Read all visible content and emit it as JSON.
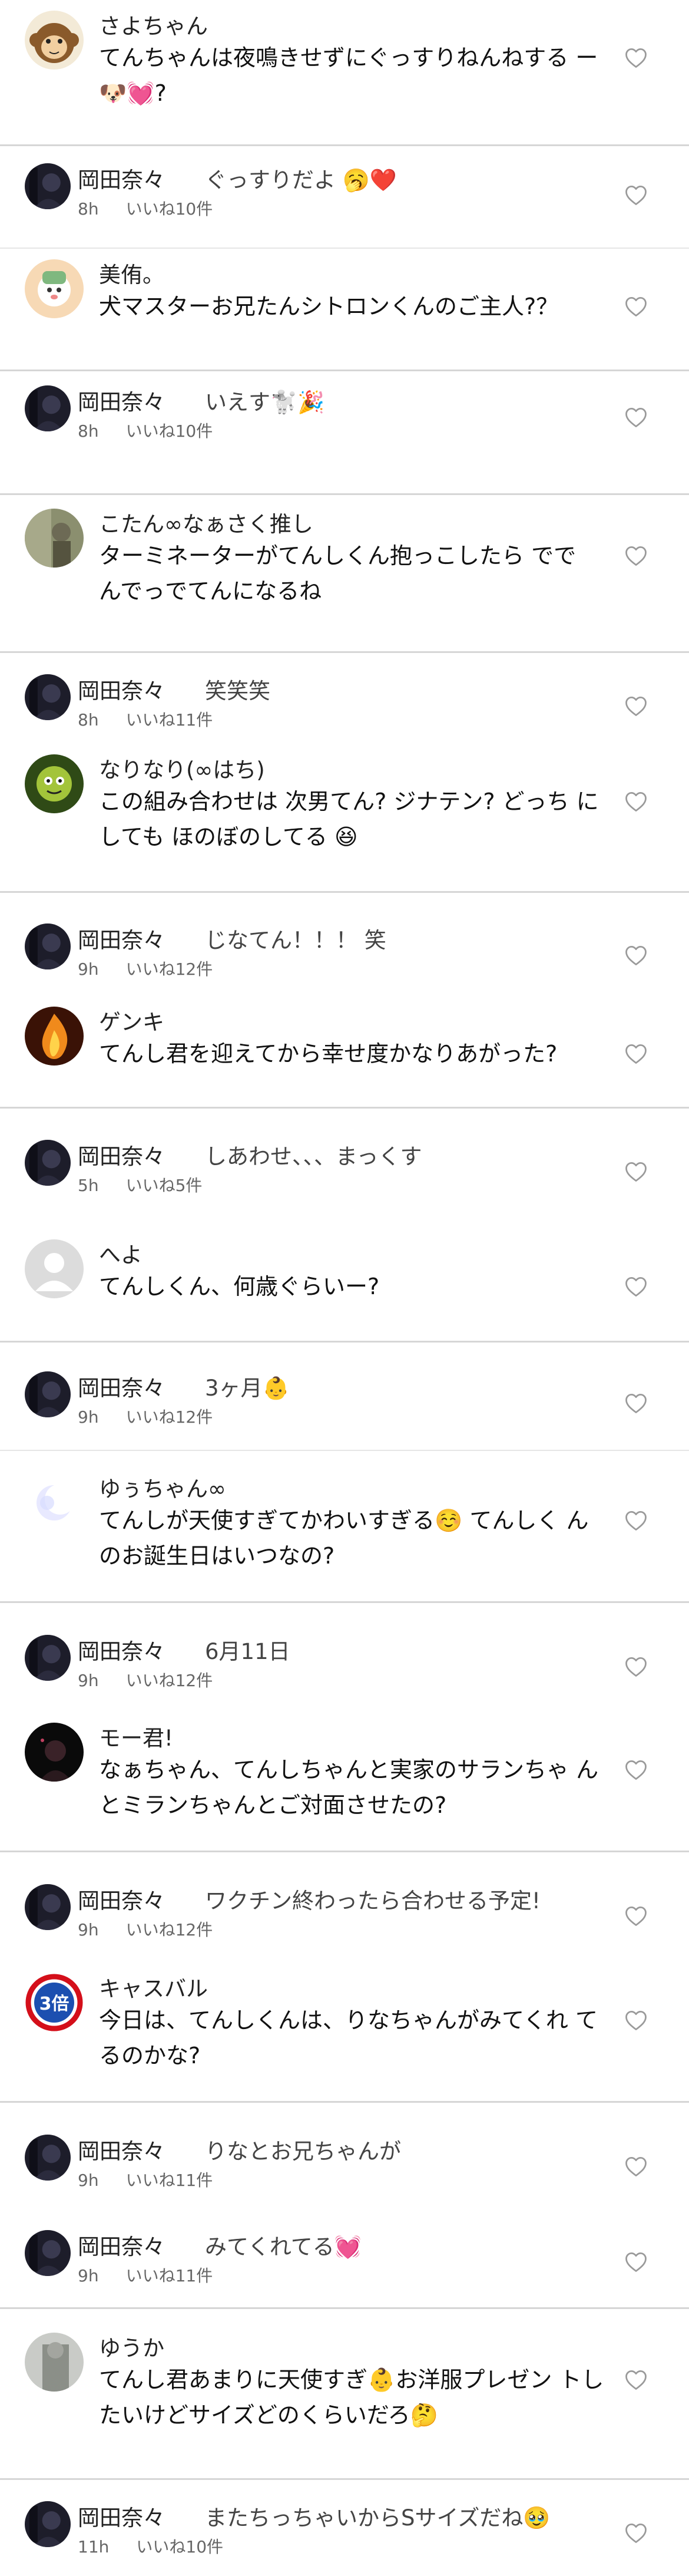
{
  "comments": [
    {
      "kind": "comment",
      "user": "さよちゃん",
      "text": "てんちゃんは夜鳴きせずにぐっすりねんねする ー🐶💓?",
      "avatar": "monkey"
    },
    {
      "kind": "reply",
      "user": "岡田奈々",
      "text": "ぐっすりだよ 🥱❤️",
      "time": "8h",
      "likes": "いいね10件",
      "avatar": "dark"
    },
    {
      "kind": "comment",
      "user": "美侑。",
      "text": "犬マスターお兄たんシトロンくんのご主人?？",
      "avatar": "cartoon"
    },
    {
      "kind": "reply",
      "user": "岡田奈々",
      "text": "いえす🐩🎉",
      "time": "8h",
      "likes": "いいね10件",
      "avatar": "dark"
    },
    {
      "kind": "comment",
      "user": "こたん∞なぁさく推し",
      "text": "ターミネーターがてんしくん抱っこしたら でで んでっでてんになるね",
      "avatar": "photo"
    },
    {
      "kind": "reply",
      "user": "岡田奈々",
      "text": "笑笑笑",
      "time": "8h",
      "likes": "いいね11件",
      "avatar": "dark"
    },
    {
      "kind": "comment",
      "user": "なりなり(∞はち)",
      "text": "この組み合わせは 次男てん? ジナテン? どっち にしても ほのぼのしてる 😆",
      "avatar": "green"
    },
    {
      "kind": "reply",
      "user": "岡田奈々",
      "text": "じなてん！！！ 笑",
      "time": "9h",
      "likes": "いいね12件",
      "avatar": "dark"
    },
    {
      "kind": "comment",
      "user": "ゲンキ",
      "text": "てんし君を迎えてから幸せ度かなりあがった?",
      "avatar": "fire"
    },
    {
      "kind": "reply",
      "user": "岡田奈々",
      "text": "しあわせ、、、まっくす",
      "time": "5h",
      "likes": "いいね5件",
      "avatar": "dark"
    },
    {
      "kind": "comment",
      "user": "へよ",
      "text": "てんしくん、何歳ぐらいー?",
      "avatar": "default"
    },
    {
      "kind": "reply",
      "user": "岡田奈々",
      "text": "3ヶ月👶",
      "time": "9h",
      "likes": "いいね12件",
      "avatar": "dark"
    },
    {
      "kind": "comment",
      "user": "ゆぅちゃん∞",
      "text": "てんしが天使すぎてかわいすぎる☺️ てんしく んのお誕生日はいつなの?",
      "avatar": "moon"
    },
    {
      "kind": "reply",
      "user": "岡田奈々",
      "text": "6月11日",
      "time": "9h",
      "likes": "いいね12件",
      "avatar": "dark"
    },
    {
      "kind": "comment",
      "user": "モー君!",
      "text": "なぁちゃん、てんしちゃんと実家のサランちゃ んとミランちゃんとご対面させたの?",
      "avatar": "black"
    },
    {
      "kind": "reply",
      "user": "岡田奈々",
      "text": "ワクチン終わったら合わせる予定!",
      "time": "9h",
      "likes": "いいね12件",
      "avatar": "dark"
    },
    {
      "kind": "comment",
      "user": "キャスバル",
      "text": "今日は、てんしくんは、りなちゃんがみてくれ てるのかな?",
      "avatar": "sign",
      "avatar_text": "3倍"
    },
    {
      "kind": "reply",
      "user": "岡田奈々",
      "text": "りなとお兄ちゃんが",
      "time": "9h",
      "likes": "いいね11件",
      "avatar": "dark"
    },
    {
      "kind": "reply",
      "user": "岡田奈々",
      "text": "みてくれてる💓",
      "time": "9h",
      "likes": "いいね11件",
      "avatar": "dark"
    },
    {
      "kind": "comment",
      "user": "ゆうか",
      "text": "てんし君あまりに天使すぎ👶お洋服プレゼン トしたいけどサイズどのくらいだろ🤔",
      "avatar": "gray"
    },
    {
      "kind": "reply",
      "user": "岡田奈々",
      "text": "またちっちゃいからSサイズだね🥹",
      "time": "11h",
      "likes": "いいね10件",
      "avatar": "dark"
    }
  ],
  "colors": {
    "divider": "#d6d6d6",
    "meta": "#666666",
    "heart": "#9a9a9a"
  }
}
